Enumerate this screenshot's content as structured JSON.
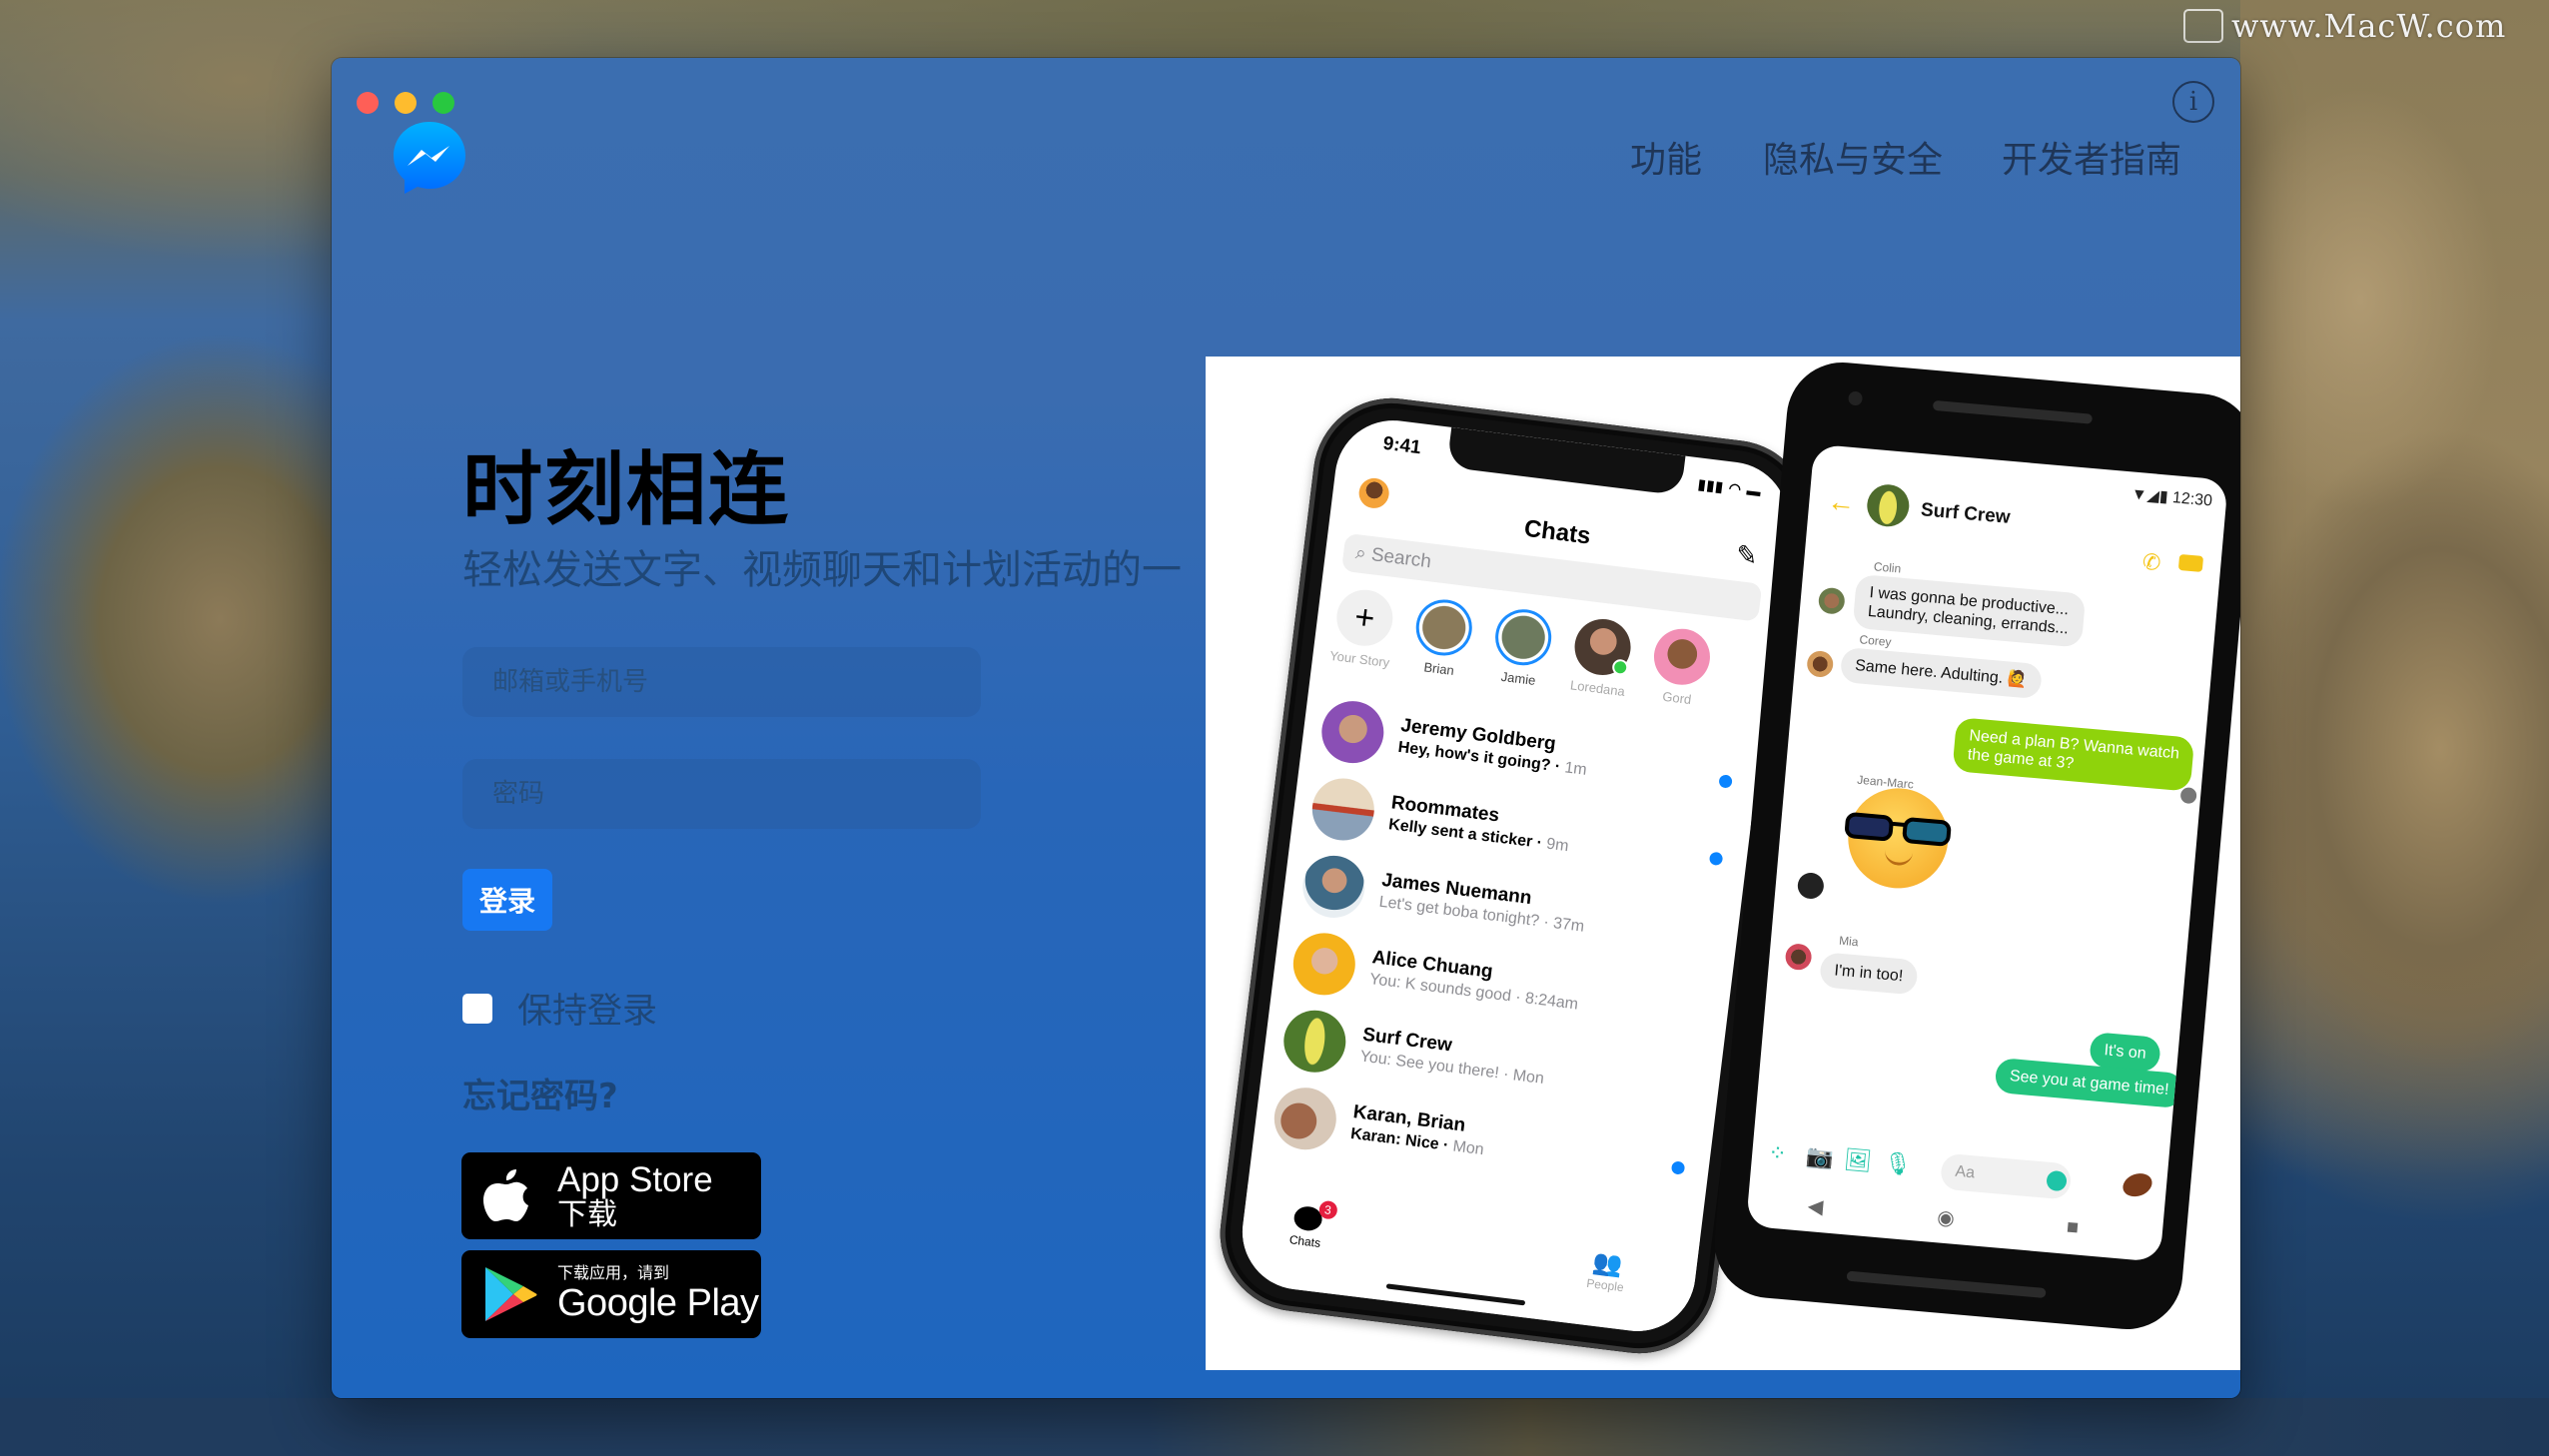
{
  "desktop": {
    "watermark": "www.MacW.com"
  },
  "window": {
    "traffic_lights": [
      "close",
      "minimize",
      "maximize"
    ],
    "logo_icon": "messenger-logo",
    "info_icon_label": "i",
    "nav": [
      {
        "label": "功能"
      },
      {
        "label": "隐私与安全"
      },
      {
        "label": "开发者指南"
      }
    ],
    "hero": {
      "title": "时刻相连",
      "subtitle": "轻松发送文字、视频聊天和计划活动的一"
    },
    "login": {
      "email_placeholder": "邮箱或手机号",
      "email_value": "",
      "password_placeholder": "密码",
      "password_value": "",
      "submit_label": "登录",
      "remember_label": "保持登录",
      "remember_checked": false,
      "forgot_label": "忘记密码?"
    },
    "badges": {
      "appstore": {
        "line1": "App Store",
        "line2": "下载"
      },
      "googleplay": {
        "line1": "下载应用，请到",
        "line2": "Google Play"
      }
    },
    "colors": {
      "accent": "#1778f2",
      "nav_text": "#1f3658",
      "window_bg": "#2b68b6"
    }
  },
  "mockup": {
    "iphone": {
      "time": "9:41",
      "title": "Chats",
      "search_placeholder": "Search",
      "stories": [
        {
          "name": "Your Story",
          "type": "add"
        },
        {
          "name": "Brian",
          "type": "unseen"
        },
        {
          "name": "Jamie",
          "type": "unseen"
        },
        {
          "name": "Loredana",
          "type": "online"
        },
        {
          "name": "Gord",
          "type": "seen"
        }
      ],
      "chats": [
        {
          "name": "Jeremy Goldberg",
          "message": "Hey, how's it going?",
          "time": "1m",
          "unread": true
        },
        {
          "name": "Roommates",
          "message": "Kelly sent a sticker",
          "time": "9m",
          "unread": true
        },
        {
          "name": "James Nuemann",
          "message": "Let's get boba tonight?",
          "time": "37m",
          "unread": false
        },
        {
          "name": "Alice Chuang",
          "message": "You: K sounds good",
          "time": "8:24am",
          "unread": false
        },
        {
          "name": "Surf Crew",
          "message": "You: See you there!",
          "time": "Mon",
          "unread": false
        },
        {
          "name": "Karan, Brian",
          "message": "Karan: Nice",
          "time": "Mon",
          "unread": true
        }
      ],
      "tabs": [
        {
          "label": "Chats",
          "badge": "3"
        },
        {
          "label": "People"
        }
      ]
    },
    "android": {
      "time": "12:30",
      "title": "Surf Crew",
      "messages": [
        {
          "sender": "Colin",
          "text": "I was gonna be productive...",
          "text2": "Laundry, cleaning, errands...",
          "dir": "in"
        },
        {
          "sender": "Corey",
          "text": "Same here. Adulting. 🙋",
          "dir": "in"
        },
        {
          "sender": "",
          "text": "Need a plan B? Wanna watch",
          "text2": "the game at 3?",
          "dir": "out"
        },
        {
          "sender": "Jean-Marc",
          "text": "😎",
          "dir": "in",
          "type": "sticker"
        },
        {
          "sender": "Mia",
          "text": "I'm in too!",
          "dir": "in"
        },
        {
          "sender": "",
          "text": "It's on",
          "dir": "out"
        },
        {
          "sender": "",
          "text": "See you at game time!",
          "dir": "out"
        }
      ],
      "composer_placeholder": "Aa"
    }
  }
}
